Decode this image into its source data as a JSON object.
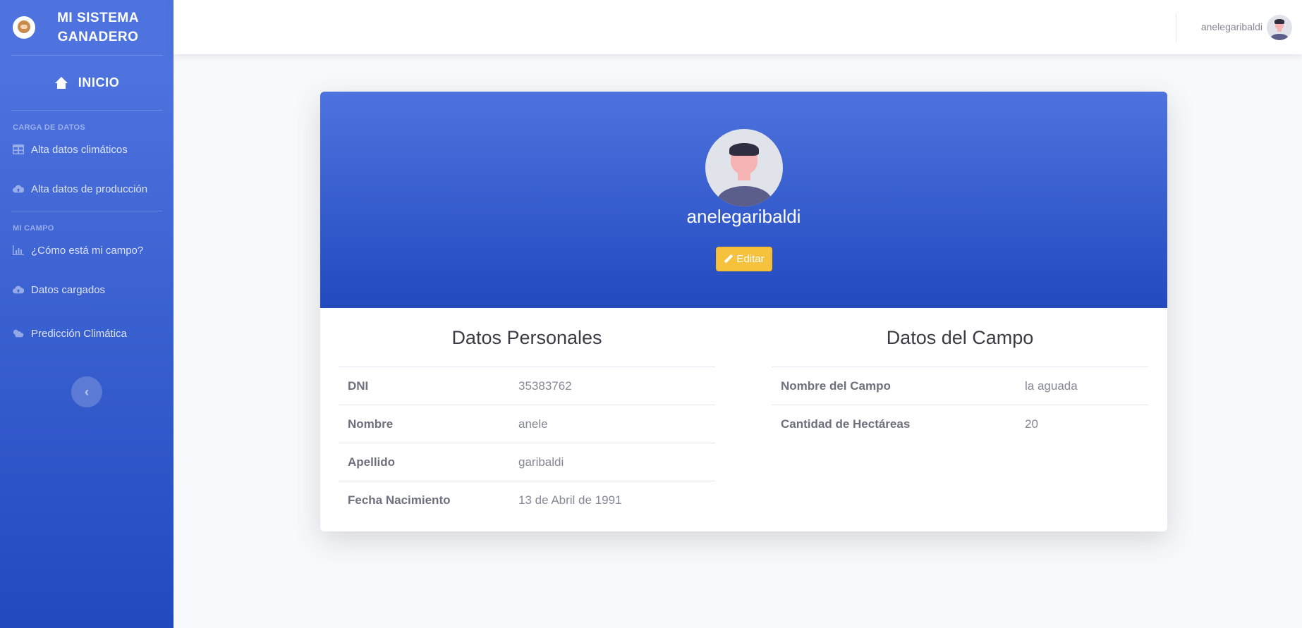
{
  "sidebar": {
    "brand": "MI SISTEMA GANADERO",
    "home": "INICIO",
    "sections": [
      {
        "heading": "CARGA DE DATOS",
        "items": [
          {
            "label": "Alta datos climáticos",
            "icon": "table-icon"
          },
          {
            "label": "Alta datos de producción",
            "icon": "cloud-upload-icon"
          }
        ]
      },
      {
        "heading": "MI CAMPO",
        "items": [
          {
            "label": "¿Cómo está mi campo?",
            "icon": "chart-area-icon"
          },
          {
            "label": "Datos cargados",
            "icon": "cloud-upload-icon"
          },
          {
            "label": "Predicción Climática",
            "icon": "cloud-sun-icon"
          }
        ]
      }
    ],
    "toggle": "‹"
  },
  "topbar": {
    "username": "anelegaribaldi"
  },
  "profile": {
    "name": "anelegaribaldi",
    "edit_label": "Editar",
    "personal": {
      "title": "Datos Personales",
      "rows": [
        {
          "label": "DNI",
          "value": "35383762"
        },
        {
          "label": "Nombre",
          "value": "anele"
        },
        {
          "label": "Apellido",
          "value": "garibaldi"
        },
        {
          "label": "Fecha Nacimiento",
          "value": "13 de Abril de 1991"
        }
      ]
    },
    "campo": {
      "title": "Datos del Campo",
      "rows": [
        {
          "label": "Nombre del Campo",
          "value": "la aguada"
        },
        {
          "label": "Cantidad de Hectáreas",
          "value": "20"
        }
      ]
    }
  },
  "colors": {
    "primary": "#4e73df",
    "primary_dark": "#224abe",
    "warning": "#f6c23e",
    "background": "#f8f9fc"
  }
}
